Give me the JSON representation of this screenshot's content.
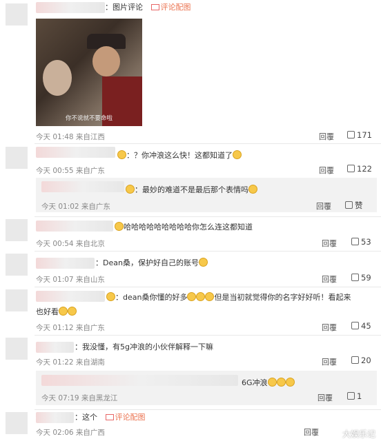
{
  "comments": [
    {
      "prefix": "：图片评论",
      "tag": "评论配图",
      "time": "今天 01:48 来自江西",
      "reply": "回覆",
      "likes": "171"
    },
    {
      "text": "：？你冲浪这么快！这都知道了",
      "time": "今天 00:55 来自广东",
      "reply": "回覆",
      "likes": "122",
      "sub": {
        "text": "：最妙的难道不是最后那个表情吗",
        "time": "今天 01:02 来自广东",
        "reply": "回覆",
        "likes": "赞"
      }
    },
    {
      "text": "哈哈哈哈哈哈哈哈哈你怎么连这都知道",
      "time": "今天 00:54 来自北京",
      "reply": "回覆",
      "likes": "53"
    },
    {
      "text": "：Dean桑，保护好自己的账号",
      "time": "今天 01:07 来自山东",
      "reply": "回覆",
      "likes": "59"
    },
    {
      "text": "：dean桑你懂的好多",
      "text2": "但是当初就觉得你的名字好好听！看起来",
      "text3": "也好看",
      "time": "今天 01:12 来自广东",
      "reply": "回覆",
      "likes": "45"
    },
    {
      "text": "：我没懂，有5g冲浪的小伙伴解释一下嘛",
      "time": "今天 01:22 来自湖南",
      "reply": "回覆",
      "likes": "20",
      "sub": {
        "text": "6G冲浪",
        "time": "今天 07:19 来自黑龙江",
        "reply": "回覆",
        "likes": "1"
      }
    },
    {
      "text": "：这个",
      "tag": "评论配图",
      "time": "今天 02:06 来自广西",
      "reply": "回覆",
      "likes": "1"
    }
  ],
  "image_caption": "你不说就不要命啦",
  "watermark": "大娱乐记"
}
